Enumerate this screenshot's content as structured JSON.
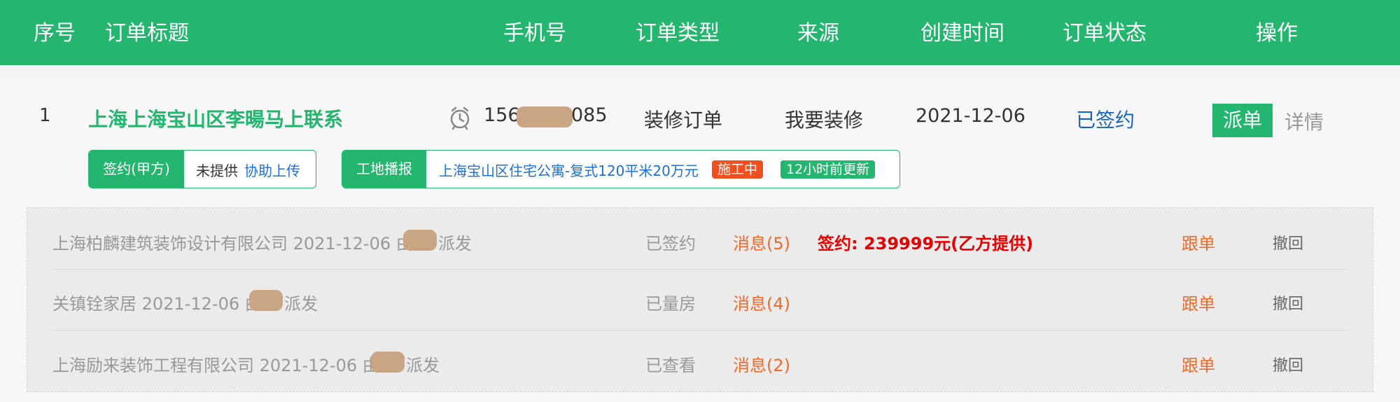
{
  "header": {
    "index": "序号",
    "title": "订单标题",
    "phone": "手机号",
    "type": "订单类型",
    "source": "来源",
    "created": "创建时间",
    "status": "订单状态",
    "action": "操作"
  },
  "order": {
    "index": "1",
    "title": "上海上海宝山区李暘马上联系",
    "phone_prefix": "156",
    "phone_suffix": "085",
    "type": "装修订单",
    "source": "我要装修",
    "created": "2021-12-06",
    "status": "已签约",
    "dispatch_label": "派单",
    "detail_label": "详情",
    "contract_tag": {
      "label": "签约(甲方)",
      "value": "未提供",
      "link": "协助上传"
    },
    "site_tag": {
      "label": "工地播报",
      "project": "上海宝山区住宅公寓-复式120平米20万元",
      "state_badge": "施工中",
      "update_badge": "12小时前更新"
    }
  },
  "dispatches": [
    {
      "company": "上海柏麟建筑装饰设计有限公司 2021-12-06 由",
      "suffix": "派发",
      "status": "已签约",
      "messages": "消息(5)",
      "contract": "签约: 239999元(乙方提供)",
      "follow": "跟单",
      "revoke": "撤回"
    },
    {
      "company": "关镇铨家居 2021-12-06 由",
      "suffix": "派发",
      "status": "已量房",
      "messages": "消息(4)",
      "contract": "",
      "follow": "跟单",
      "revoke": "撤回"
    },
    {
      "company": "上海励来装饰工程有限公司 2021-12-06 由",
      "suffix": "派发",
      "status": "已查看",
      "messages": "消息(2)",
      "contract": "",
      "follow": "跟单",
      "revoke": "撤回"
    }
  ],
  "icons": {
    "clock": "alarm-clock-icon"
  },
  "colors": {
    "brand_green": "#24b56f",
    "link_blue": "#1e6fd9",
    "status_blue": "#1565c0",
    "orange": "#f06a2b",
    "red": "#e60000",
    "badge_orange": "#f0501e"
  }
}
